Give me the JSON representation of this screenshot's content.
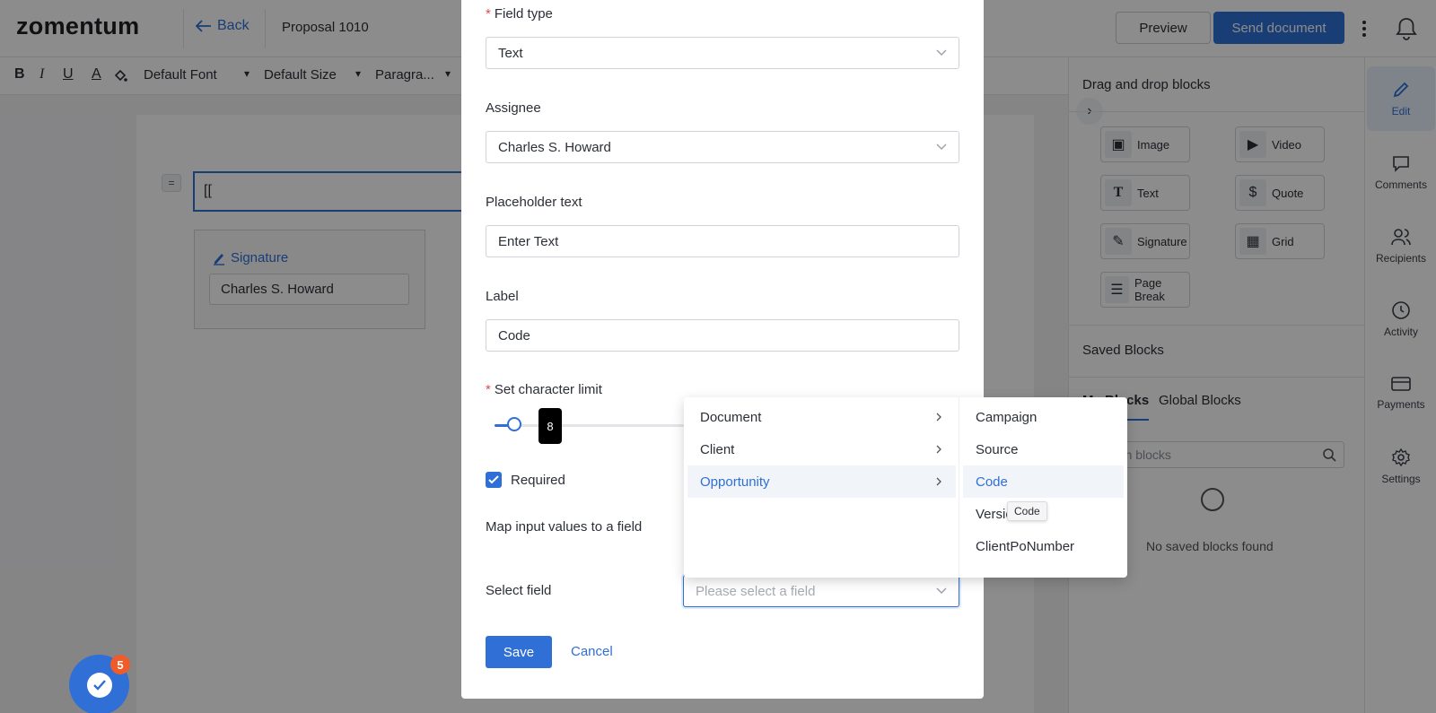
{
  "header": {
    "logo": "zomentum",
    "back_label": "Back",
    "doc_title": "Proposal 1010",
    "preview_label": "Preview",
    "send_label": "Send document"
  },
  "toolbar": {
    "bold": "B",
    "italic": "I",
    "underline": "U",
    "font_color": "A",
    "font": "Default Font",
    "size": "Default Size",
    "paragraph": "Paragra..."
  },
  "canvas": {
    "text_block_value": "[[",
    "signature_label": "Signature",
    "signature_value": "Charles S. Howard"
  },
  "right_panel": {
    "title": "Drag and drop blocks",
    "blocks": [
      {
        "label": "Image",
        "icon": "image-icon"
      },
      {
        "label": "Video",
        "icon": "video-icon"
      },
      {
        "label": "Text",
        "icon": "text-icon"
      },
      {
        "label": "Quote",
        "icon": "dollar-icon"
      },
      {
        "label": "Signature",
        "icon": "signature-icon"
      },
      {
        "label": "Grid",
        "icon": "grid-icon"
      },
      {
        "label": "Page Break",
        "icon": "page-break-icon"
      }
    ],
    "saved_title": "Saved Blocks",
    "tab_my": "My Blocks",
    "tab_global": "Global Blocks",
    "search_placeholder": "Search blocks",
    "empty_text": "No saved blocks found"
  },
  "rail": {
    "items": [
      {
        "label": "Edit",
        "icon": "edit-icon"
      },
      {
        "label": "Comments",
        "icon": "comments-icon"
      },
      {
        "label": "Recipients",
        "icon": "recipients-icon"
      },
      {
        "label": "Activity",
        "icon": "clock-icon"
      },
      {
        "label": "Payments",
        "icon": "payments-icon"
      },
      {
        "label": "Settings",
        "icon": "settings-icon"
      }
    ]
  },
  "modal": {
    "field_type_label": "Field type",
    "field_type_value": "Text",
    "assignee_label": "Assignee",
    "assignee_value": "Charles S. Howard",
    "placeholder_label": "Placeholder text",
    "placeholder_value": "Enter Text",
    "label_label": "Label",
    "label_value": "Code",
    "char_limit_label": "Set character limit",
    "char_limit_value": "8",
    "required_label": "Required",
    "map_label": "Map input values to a field",
    "select_field_label": "Select field",
    "select_field_placeholder": "Please select a field",
    "save_label": "Save",
    "cancel_label": "Cancel"
  },
  "cascader": {
    "level1": [
      "Document",
      "Client",
      "Opportunity"
    ],
    "level2": [
      "Campaign",
      "Source",
      "Code",
      "Versio",
      "ClientPoNumber"
    ],
    "tooltip": "Code"
  },
  "float": {
    "badge": "5"
  },
  "colors": {
    "accent": "#2f6fd6",
    "required": "#e5484d",
    "badge": "#f05b2a"
  }
}
